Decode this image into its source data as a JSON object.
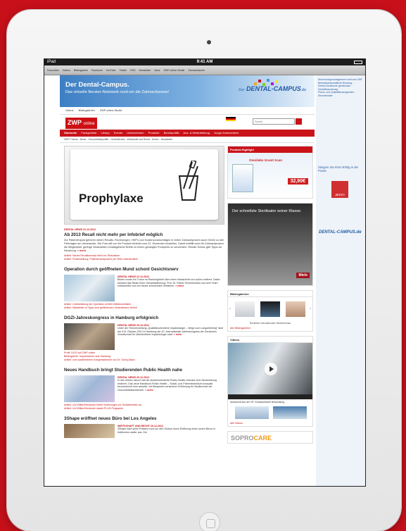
{
  "device": {
    "carrier": "iPad",
    "time": "9:41 AM"
  },
  "bookmarks": [
    "Favourites",
    "Videos",
    "Bildergalerie",
    "Facebook",
    "YouTube",
    "Twitter",
    "RSS",
    "Newsletter",
    "Abos",
    "ZWP online-Studie",
    "Zahnarztsuche"
  ],
  "banner": {
    "title": "Der Dental-Campus.",
    "subtitle": "Das virtuelle Berater-Netzwerk rund um die Zahnarztpraxis!",
    "logo": "DENTAL-CAMPUS",
    "logo_tld": ".de",
    "logo_prefix": "Der"
  },
  "top_links": [
    "Videos",
    "Bildergalerien",
    "ZWP online-Studie"
  ],
  "logo": {
    "brand": "ZWP",
    "suffix": "online"
  },
  "search_placeholder": "Suche",
  "nav": [
    "Startseite",
    "Fachgebiete",
    "Library",
    "Events",
    "Unternehmen",
    "Produkte",
    "Berufspolitik",
    "Aus- & Weiterbildung",
    "Junge Zahnmedizin"
  ],
  "subnav": "ZWP Thema · News · Gesundheitspolitik · Gerichtliches · Wirtschaft und Recht · Archiv · Newsletter",
  "hero": {
    "word": "Prophylaxe"
  },
  "lead_article": {
    "meta": "DENTAL NEWS 21.12.2012",
    "title": "Ab 2013 Recall nicht mehr per Infobrief möglich",
    "text": "Zur Patientenpost gehören neben Recalls, Rechnungen, HKP's und Kostenvoranschlägen in vielen Zahnarztpraxen auch Grüße zu den Feiertagen am Jahresende. Die Post will nun für Produkt Infobrief zum 31. Dezember einstellen. Damit entfällt auch für Zahnarztpraxen die Möglichkeit, geringe Stückzahlen inhaltsgleicher Briefe zu einem günstigen Portopreis zu versenden. Renate Schulz gibt Tipps zur Neuerung.",
    "more": "» mehr",
    "related": [
      "Artikel: Neues Recallkonzept steht zur Diskussion",
      "Artikel: Praxisstellung, Patientenansprache per Brief unbedenklich"
    ]
  },
  "articles": [
    {
      "title": "Operation durch geöffneten Mund schont Gesichtsnerv",
      "meta": "DENTAL NEWS 21.12.2012",
      "text": "Bisher wurde ein Tumor im Rachengebiet über einen Hautschnitt von außen entfernt. Dabei bestand das Risiko einer Gesichtslähmung. Prof. Dr. Rainer Schmelzeisen und sein Team entwickelten nun ein neues schonendes Verfahren.",
      "more": "» mehr",
      "related": [
        "Artikel: Unterstützung der Operation erhöht Infektionsrisiken",
        "Artikel: Mitarbeiter in Tipps zum gefährlichen Gesichtsnerv befreit"
      ]
    },
    {
      "title": "DGZI-Jahreskongress in Hamburg erfolgreich",
      "meta": "DENTAL NEWS 20.12.2012",
      "text": "Unter der Themenstellung „Qualitätsorientierte Implantologie – Wege zum Langzeiterfolg\" fand am 5./6. Oktober 2012 in Hamburg der 42. Internationale Jahreskongress der Deutschen Gesellschaft für Zahnärztliche Implantologie statt.",
      "more": "» mehr",
      "related": [
        "Profil: DGZI auf ZWP online",
        "Bildergalerie: Impressionen aus Hamburg",
        "Artikel: zum ausführlichen Kongressbericht von Dr. Georg Bach"
      ]
    },
    {
      "title": "Neues Handbuch bringt Studierenden Public Health nahe",
      "meta": "DENTAL NEWS 20.12.2012",
      "text": "In den letzten Jahren hat die studienorientierte Public-Health-Literatur eine Neubelebung erfahren. Das neue Handbuch Public Health – Sozial- und Präventivmedizin kompakt kennzeichnet eine aktuelle, mit Beispielen versehene Einführung für Studierende der Gesundheitsfachberufe.",
      "more": "» mehr",
      "related": [
        "Artikel: Uni Witten/Herdecke bietet Vorlesungen zur Schlafmedizin an",
        "Artikel: Uni Witten/Herdecke startet PLUS-Programm"
      ]
    },
    {
      "title": "3Shape eröffnet neues Büro bei Los Angeles",
      "meta": "WIRTSCHAFT UND RECHT 20.12.2012",
      "text": "3Shape baut seine Präsenz rund um den Globus durch Eröffnung eines neuen Büros in Kalifornien weiter aus. Die",
      "more": "",
      "related": []
    }
  ],
  "product_highlight": {
    "header": "Produkt-Highlight",
    "name": "Omnilabs Granit Scan",
    "price": "32,90€"
  },
  "ad_sterilisator": {
    "text": "Der schnellste Sterilisator seiner Klasse.",
    "brand": "Miele"
  },
  "gallery": {
    "header": "Bildergalerien",
    "caption": "Rückblick internationaler Medizinschau",
    "more": "Alle Bildergalerien"
  },
  "videos": {
    "header": "Videos",
    "caption": "Ausschnitt aus der OP: Endodontische Behandlung",
    "more": "Alle Videos"
  },
  "soprocare": {
    "part1": "SOPRO",
    "part2": "CARE"
  },
  "sidebar": {
    "items": [
      "Abrechnungsmanagement rund ums ZMF",
      "Betriebswirtschaftliche Beratung",
      "Dental-Sachkunde gemeinsam",
      "Dentalfinanzierung",
      "Praxis- und Qualitätsmanagement",
      "Steuerberater"
    ],
    "cta": "Steigern Sie Ihren Erfolg in der Praxis",
    "button": "JETZT!",
    "logo": "DENTAL-CAMPUS.de"
  }
}
